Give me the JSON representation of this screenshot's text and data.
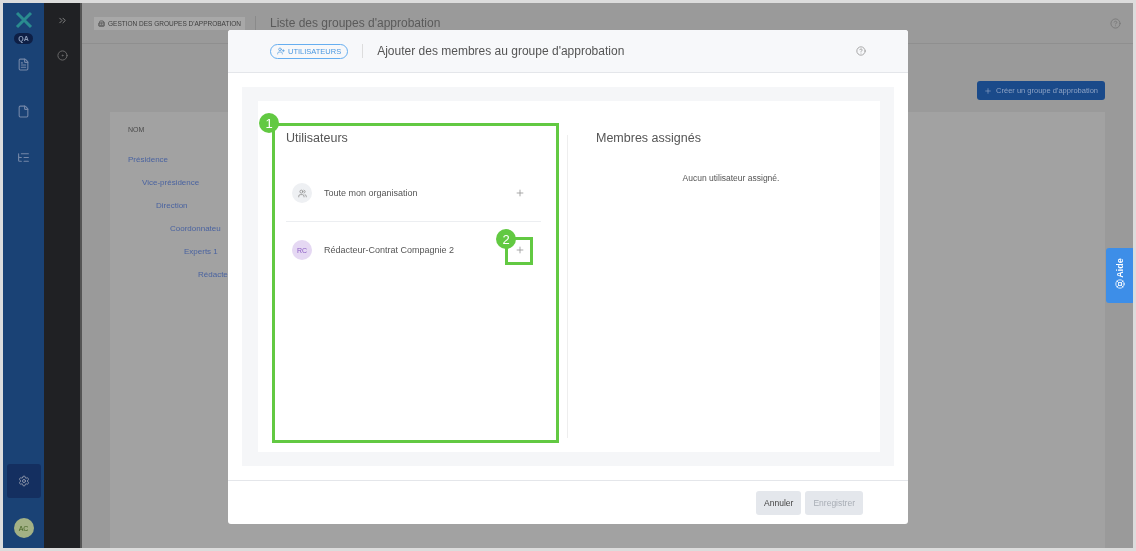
{
  "app": {
    "badge": "QA",
    "avatar": "AC"
  },
  "header": {
    "breadcrumb": "GESTION DES GROUPES D'APPROBATION",
    "title": "Liste des groupes d'approbation"
  },
  "create_button": "Créer un groupe d'approbation",
  "table": {
    "columns": [
      "NOM"
    ],
    "tree": [
      {
        "label": "Présidence",
        "children": [
          {
            "label": "Vice-présidence",
            "children": [
              {
                "label": "Direction",
                "children": [
                  {
                    "label": "Coordonnateu",
                    "children": [
                      {
                        "label": "Experts 1",
                        "children": [
                          {
                            "label": "Rédacte"
                          }
                        ]
                      }
                    ]
                  }
                ]
              }
            ]
          }
        ]
      }
    ]
  },
  "modal": {
    "tag": "UTILISATEURS",
    "title": "Ajouter des membres au groupe d'approbation",
    "users_panel": {
      "title": "Utilisateurs",
      "items": [
        {
          "kind": "group",
          "name": "Toute mon organisation"
        },
        {
          "kind": "user",
          "initials": "RC",
          "name": "Rédacteur-Contrat Compagnie 2"
        }
      ]
    },
    "assigned_panel": {
      "title": "Membres assignés",
      "empty": "Aucun utilisateur assigné."
    },
    "buttons": [
      {
        "label": "Annuler",
        "disabled": false
      },
      {
        "label": "Enregistrer",
        "disabled": true
      }
    ]
  },
  "help_tab": "Aide",
  "callouts": [
    {
      "number": "1"
    },
    {
      "number": "2"
    }
  ]
}
